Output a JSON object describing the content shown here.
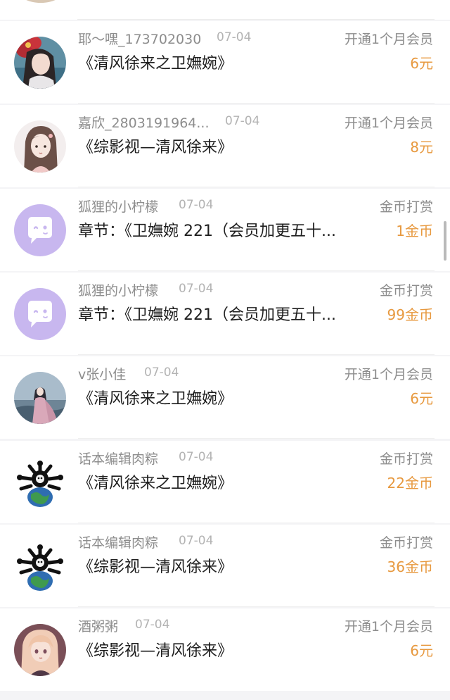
{
  "colors": {
    "amount": "#e7993f",
    "name": "#8d8d8d",
    "date": "#b3b3b3",
    "title": "#1e1e1e",
    "background": "#ffffff"
  },
  "items": [
    {
      "avatar": "avatar-red-hair-girl",
      "name": "耶～嘿_173702030",
      "date": "07-04",
      "type": "开通1个月会员",
      "title": "《清风徐来之卫嫵婉》",
      "amount": "6元"
    },
    {
      "avatar": "avatar-sketch-girl",
      "name": "嘉欣_2803191964...",
      "date": "07-04",
      "type": "开通1个月会员",
      "title": "《综影视—清风徐来》",
      "amount": "8元"
    },
    {
      "avatar": "avatar-purple-chat-icon",
      "name": "狐狸的小柠檬",
      "date": "07-04",
      "type": "金币打赏",
      "title": "章节：《卫嫵婉 221（会员加更五十...",
      "amount": "1金币"
    },
    {
      "avatar": "avatar-purple-chat-icon",
      "name": "狐狸的小柠檬",
      "date": "07-04",
      "type": "金币打赏",
      "title": "章节：《卫嫵婉 221（会员加更五十...",
      "amount": "99金币"
    },
    {
      "avatar": "avatar-hanfu-girl",
      "name": "v张小佳",
      "date": "07-04",
      "type": "开通1个月会员",
      "title": "《清风徐来之卫嫵婉》",
      "amount": "6元"
    },
    {
      "avatar": "avatar-planet-creature",
      "name": "话本编辑肉粽",
      "date": "07-04",
      "type": "金币打赏",
      "title": "《清风徐来之卫嫵婉》",
      "amount": "22金币"
    },
    {
      "avatar": "avatar-planet-creature",
      "name": "话本编辑肉粽",
      "date": "07-04",
      "type": "金币打赏",
      "title": "《综影视—清风徐来》",
      "amount": "36金币"
    },
    {
      "avatar": "avatar-anime-girl",
      "name": "酒粥粥",
      "date": "07-04",
      "type": "开通1个月会员",
      "title": "《综影视—清风徐来》",
      "amount": "6元"
    }
  ]
}
